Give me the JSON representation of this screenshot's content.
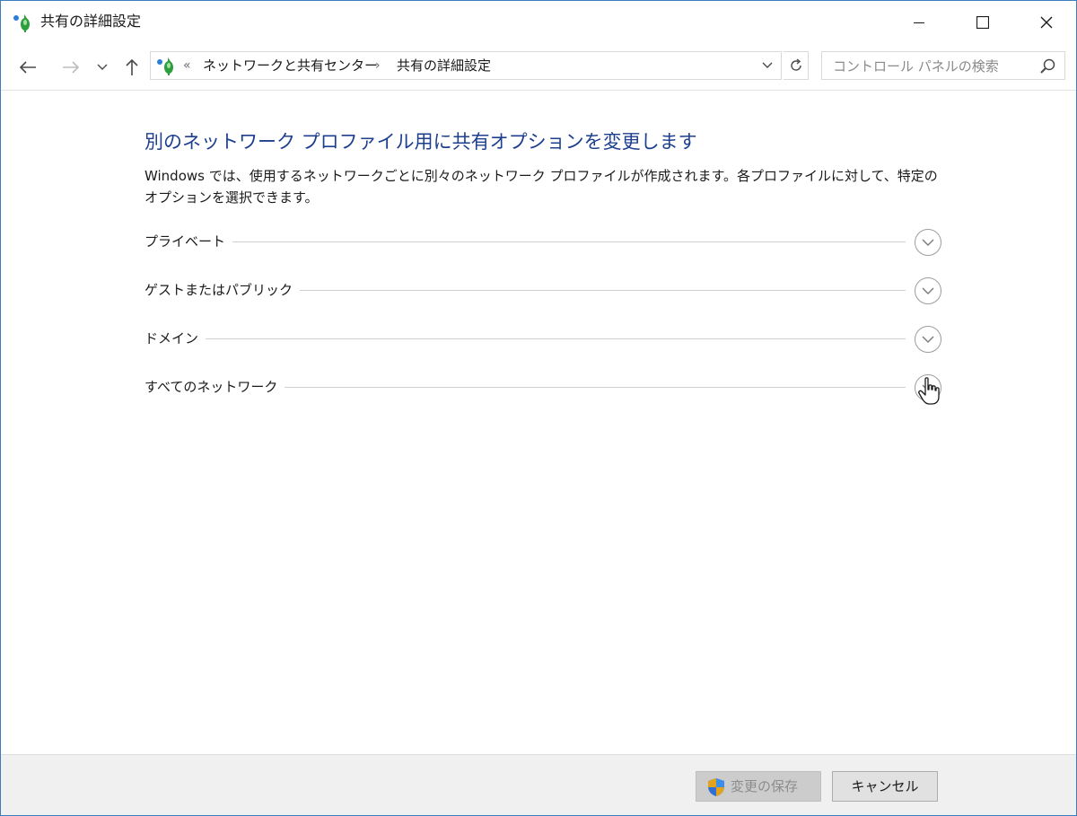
{
  "window": {
    "title": "共有の詳細設定"
  },
  "nav": {
    "breadcrumb": [
      "ネットワークと共有センター",
      "共有の詳細設定"
    ],
    "overflow_chevron": "«",
    "separator": "›",
    "search_placeholder": "コントロール パネルの検索"
  },
  "main": {
    "heading": "別のネットワーク プロファイル用に共有オプションを変更します",
    "description": "Windows では、使用するネットワークごとに別々のネットワーク プロファイルが作成されます。各プロファイルに対して、特定のオプションを選択できます。",
    "profiles": [
      {
        "label": "プライベート",
        "expanded": false
      },
      {
        "label": "ゲストまたはパブリック",
        "expanded": false
      },
      {
        "label": "ドメイン",
        "expanded": false
      },
      {
        "label": "すべてのネットワーク",
        "expanded": false
      }
    ]
  },
  "footer": {
    "save_label": "変更の保存",
    "save_enabled": false,
    "cancel_label": "キャンセル"
  },
  "colors": {
    "heading": "#1e3f8f",
    "window_border": "#3c7dbd",
    "footer_bg": "#f0f0f0"
  },
  "icons": {
    "app": "network-sharing-icon",
    "back": "arrow-left-icon",
    "forward": "arrow-right-icon",
    "recent": "chevron-down-icon",
    "up": "arrow-up-icon",
    "refresh": "refresh-icon",
    "search": "search-icon",
    "expand": "chevron-down-circle-icon",
    "uac": "uac-shield-icon",
    "cursor": "hand-pointer-icon"
  }
}
